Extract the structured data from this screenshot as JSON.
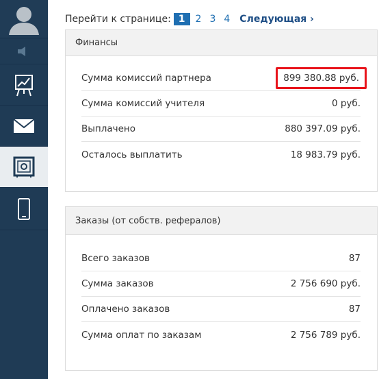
{
  "sidebar": {
    "items": [
      {
        "icon": "user-avatar-icon"
      },
      {
        "icon": "speaker-icon"
      },
      {
        "icon": "chart-easel-icon"
      },
      {
        "icon": "mail-icon"
      },
      {
        "icon": "safe-icon",
        "active": true
      },
      {
        "icon": "phone-icon"
      }
    ]
  },
  "pagination": {
    "label": "Перейти к странице:",
    "pages": [
      "1",
      "2",
      "3",
      "4"
    ],
    "current": "1",
    "next_label": "Следующая ›"
  },
  "finance": {
    "title": "Финансы",
    "rows": [
      {
        "label": "Сумма комиссий партнера",
        "value": "899 380.88 руб."
      },
      {
        "label": "Сумма комиссий учителя",
        "value": "0 руб."
      },
      {
        "label": "Выплачено",
        "value": "880 397.09 руб."
      },
      {
        "label": "Осталось выплатить",
        "value": "18 983.79 руб."
      }
    ]
  },
  "orders": {
    "title": "Заказы (от собств. рефералов)",
    "rows": [
      {
        "label": "Всего заказов",
        "value": "87"
      },
      {
        "label": "Сумма заказов",
        "value": "2 756 690 руб."
      },
      {
        "label": "Оплачено заказов",
        "value": "87"
      },
      {
        "label": "Сумма оплат по заказам",
        "value": "2 756 789 руб."
      }
    ]
  },
  "colors": {
    "sidebar_bg": "#1f3b55",
    "accent": "#1f6fb2",
    "highlight_border": "#e8141b"
  }
}
